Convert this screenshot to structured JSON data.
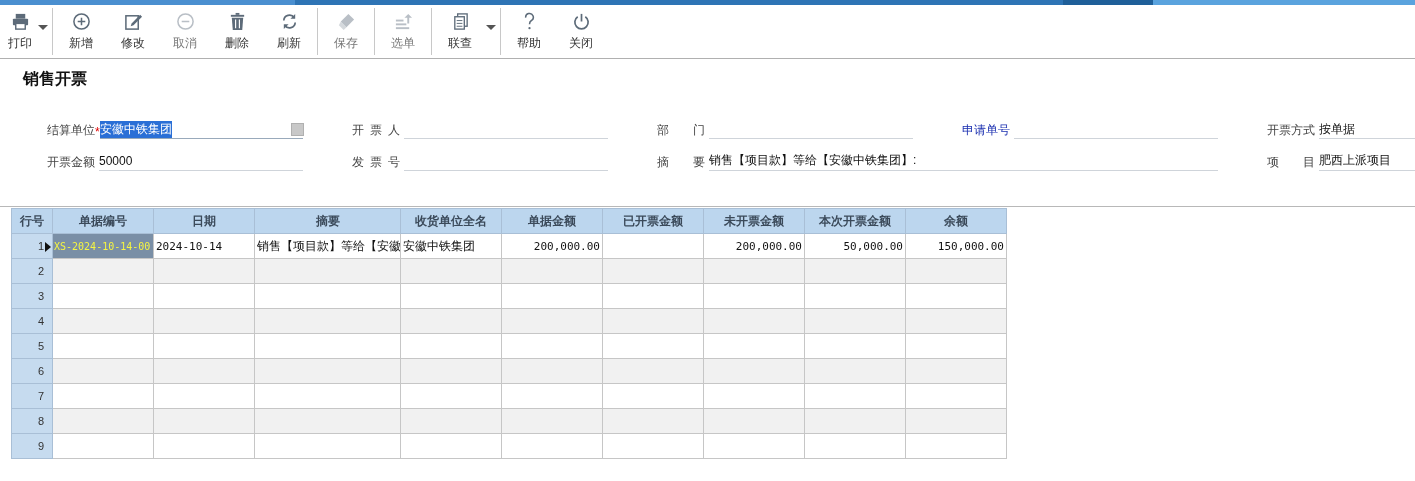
{
  "toolbar": {
    "groups": [
      {
        "buttons": [
          {
            "label": "打印",
            "disabled": false,
            "dropdown": true
          }
        ]
      },
      {
        "buttons": [
          {
            "label": "新增",
            "disabled": false,
            "dropdown": false
          },
          {
            "label": "修改",
            "disabled": false,
            "dropdown": false
          },
          {
            "label": "取消",
            "disabled": true,
            "dropdown": false
          },
          {
            "label": "删除",
            "disabled": false,
            "dropdown": false
          },
          {
            "label": "刷新",
            "disabled": false,
            "dropdown": false
          }
        ]
      },
      {
        "buttons": [
          {
            "label": "保存",
            "disabled": true,
            "dropdown": false
          }
        ]
      },
      {
        "buttons": [
          {
            "label": "选单",
            "disabled": true,
            "dropdown": false
          }
        ]
      },
      {
        "buttons": [
          {
            "label": "联查",
            "disabled": false,
            "dropdown": true
          }
        ]
      },
      {
        "buttons": [
          {
            "label": "帮助",
            "disabled": false,
            "dropdown": false
          },
          {
            "label": "关闭",
            "disabled": false,
            "dropdown": false
          }
        ]
      }
    ]
  },
  "page_title": "销售开票",
  "form": {
    "rows": [
      {
        "fields": [
          {
            "kind": "lookup",
            "label": "结算单位",
            "required_mark": "*",
            "value": "安徽中铁集团",
            "selected": true
          },
          {
            "kind": "plain",
            "label": "开 票 人",
            "selected": false
          },
          {
            "kind": "plain",
            "label": "部 门",
            "selected": false
          },
          {
            "kind": "link",
            "label": "申请单号",
            "selected": false
          },
          {
            "kind": "plain",
            "label": "开票方式",
            "value": "按单据",
            "selected": false
          }
        ]
      },
      {
        "fields": [
          {
            "kind": "plain",
            "label": "开票金额",
            "value": "50000",
            "selected": false
          },
          {
            "kind": "plain",
            "label": "发 票 号",
            "selected": false
          },
          {
            "kind": "wide",
            "label": "摘 要",
            "value": "销售【项目款】等给【安徽中铁集团】:",
            "selected": false
          },
          {
            "kind": "plain",
            "label": "项 目",
            "value": "肥西上派项目",
            "selected": false
          }
        ]
      }
    ]
  },
  "table": {
    "columns": [
      "行号",
      "单据编号",
      "日期",
      "摘要",
      "收货单位全名",
      "单据金额",
      "已开票金额",
      "未开票金额",
      "本次开票金额",
      "余额"
    ],
    "rows": [
      {
        "row_no": "1",
        "selected": true,
        "cells": [
          "XS-2024-10-14-00",
          "2024-10-14",
          "销售【项目款】等给【安徽",
          "安徽中铁集团",
          "200,000.00",
          null,
          "200,000.00",
          "50,000.00",
          "150,000.00"
        ]
      },
      {
        "row_no": "2",
        "selected": false
      },
      {
        "row_no": "3",
        "selected": false
      },
      {
        "row_no": "4",
        "selected": false
      },
      {
        "row_no": "5",
        "selected": false
      },
      {
        "row_no": "6",
        "selected": false
      },
      {
        "row_no": "7",
        "selected": false
      },
      {
        "row_no": "8",
        "selected": false
      },
      {
        "row_no": "9",
        "selected": false
      }
    ]
  }
}
